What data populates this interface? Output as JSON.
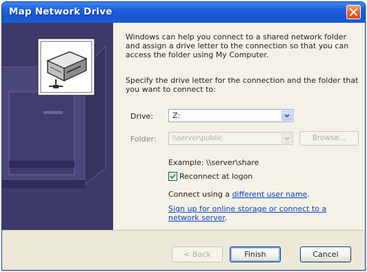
{
  "window": {
    "title": "Map Network Drive"
  },
  "intro_text": "Windows can help you connect to a shared network folder and assign a drive letter to the connection so that you can access the folder using My Computer.",
  "specify_text": "Specify the drive letter for the connection and the folder that you want to connect to:",
  "drive": {
    "label": "Drive:",
    "value": "Z:"
  },
  "folder": {
    "label": "Folder:",
    "value": "\\\\server\\public",
    "browse_label": "Browse..."
  },
  "example_text": "Example: \\\\server\\share",
  "reconnect": {
    "label": "Reconnect at logon",
    "checked": true
  },
  "connect_different": {
    "prefix": "Connect using a ",
    "link": "different user name",
    "suffix": "."
  },
  "signup": {
    "link": "Sign up for online storage or connect to a network server",
    "suffix": "."
  },
  "buttons": {
    "back": "< Back",
    "finish": "Finish",
    "cancel": "Cancel"
  },
  "colors": {
    "titlebar": "#1f63dc",
    "side_panel": "#3d3a69",
    "link": "#0a3fc2",
    "close_button": "#e2612e"
  },
  "icons": {
    "close": "close-icon",
    "drive": "network-drive-icon",
    "dropdown": "chevron-down-icon",
    "check": "checkmark-icon"
  }
}
